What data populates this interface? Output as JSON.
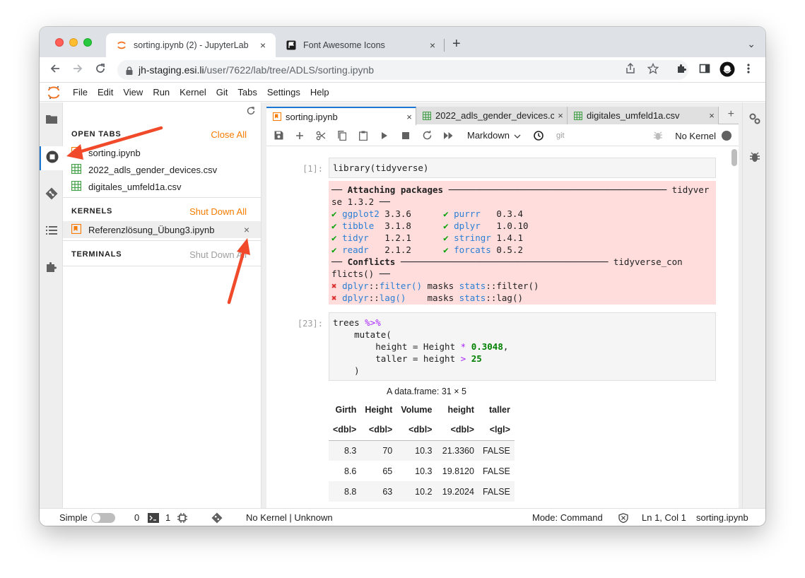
{
  "browser": {
    "tabs": [
      {
        "title": "sorting.ipynb (2) - JupyterLab",
        "close": "×",
        "active": true
      },
      {
        "title": "Font Awesome Icons",
        "close": "×",
        "active": false
      }
    ],
    "new_tab": "+",
    "tab_menu": "⌄",
    "url_host": "jh-staging.esi.li",
    "url_path": "/user/7622/lab/tree/ADLS/sorting.ipynb"
  },
  "menubar": {
    "items": [
      "File",
      "Edit",
      "View",
      "Run",
      "Kernel",
      "Git",
      "Tabs",
      "Settings",
      "Help"
    ]
  },
  "sidebar": {
    "open_tabs_header": "OPEN TABS",
    "close_all": "Close All",
    "open_tabs": [
      {
        "name": "sorting.ipynb",
        "icon": "notebook-icon"
      },
      {
        "name": "2022_adls_gender_devices.csv",
        "icon": "spreadsheet-icon"
      },
      {
        "name": "digitales_umfeld1a.csv",
        "icon": "spreadsheet-icon"
      }
    ],
    "kernels_header": "KERNELS",
    "shut_down_all_kernels": "Shut Down All",
    "kernels": [
      {
        "name": "Referenzlösung_Übung3.ipynb",
        "close": "×"
      }
    ],
    "terminals_header": "TERMINALS",
    "shut_down_all_terminals": "Shut Down All"
  },
  "doc_tabs": [
    {
      "title": "sorting.ipynb",
      "close": "×",
      "active": true
    },
    {
      "title": "2022_adls_gender_devices.csv",
      "close": "×",
      "active": false
    },
    {
      "title": "digitales_umfeld1a.csv",
      "close": "×",
      "active": false
    }
  ],
  "doc_tab_add": "+",
  "nb_toolbar": {
    "cell_type": "Markdown",
    "git_label": "git",
    "kernel_name": "No Kernel"
  },
  "cells": {
    "cell1_prompt": "[1]:",
    "cell1_code": "library(tidyverse)",
    "out1": {
      "line1_bold": "── Attaching packages ",
      "line1_rule": "─────────────────────────────────────────",
      "line1_tail": " tidyver",
      "line2": "se 1.3.2 ──",
      "packages": [
        {
          "left_name": "ggplot2",
          "left_ver": "3.3.6",
          "right_name": "purrr",
          "right_ver": "0.3.4"
        },
        {
          "left_name": "tibble",
          "left_ver": "3.1.8",
          "right_name": "dplyr",
          "right_ver": "1.0.10"
        },
        {
          "left_name": "tidyr",
          "left_ver": "1.2.1",
          "right_name": "stringr",
          "right_ver": "1.4.1"
        },
        {
          "left_name": "readr",
          "left_ver": "2.1.2",
          "right_name": "forcats",
          "right_ver": "0.5.2"
        }
      ],
      "check": "✔",
      "conflicts_bold": "── Conflicts ",
      "conflicts_rule": "───────────────────────────────────────",
      "conflicts_tail": " tidyverse_con",
      "conflicts_line2": "flicts() ──",
      "conflict_rows": [
        {
          "pkg": "dplyr",
          "fn": "filter()",
          "masks": " masks ",
          "other": "stats",
          "ofn": "filter()",
          "pad": ""
        },
        {
          "pkg": "dplyr",
          "fn": "lag()",
          "masks": "    masks ",
          "other": "stats",
          "ofn": "lag()",
          "pad": ""
        }
      ],
      "cross": "✖",
      "sep": "::"
    },
    "cell2_prompt": "[23]:",
    "cell2": {
      "l1_a": "trees ",
      "l1_op": "%>%",
      "l2": "    mutate(",
      "l3_a": "        height = Height ",
      "l3_op": "*",
      "l3_num": "0.3048",
      "l3_b": ",",
      "l4_a": "        taller = height ",
      "l4_op": ">",
      "l4_num": "25",
      "l5": "    )"
    },
    "df_caption": "A data.frame: 31 × 5",
    "df_headers": [
      "Girth",
      "Height",
      "Volume",
      "height",
      "taller"
    ],
    "df_types": [
      "<dbl>",
      "<dbl>",
      "<dbl>",
      "<dbl>",
      "<lgl>"
    ],
    "df_rows": [
      [
        "8.3",
        "70",
        "10.3",
        "21.3360",
        "FALSE"
      ],
      [
        "8.6",
        "65",
        "10.3",
        "19.8120",
        "FALSE"
      ],
      [
        "8.8",
        "63",
        "10.2",
        "19.2024",
        "FALSE"
      ]
    ]
  },
  "statusbar": {
    "simple": "Simple",
    "terminals_count": "0",
    "kernels_count": "1",
    "kernel_status": "No Kernel | Unknown",
    "mode": "Mode: Command",
    "position": "Ln 1, Col 1",
    "filename": "sorting.ipynb"
  },
  "colors": {
    "accent": "#1976d2",
    "orange": "#f57c00",
    "arrow": "#f04a2a",
    "error_bg": "#ffdddd"
  }
}
